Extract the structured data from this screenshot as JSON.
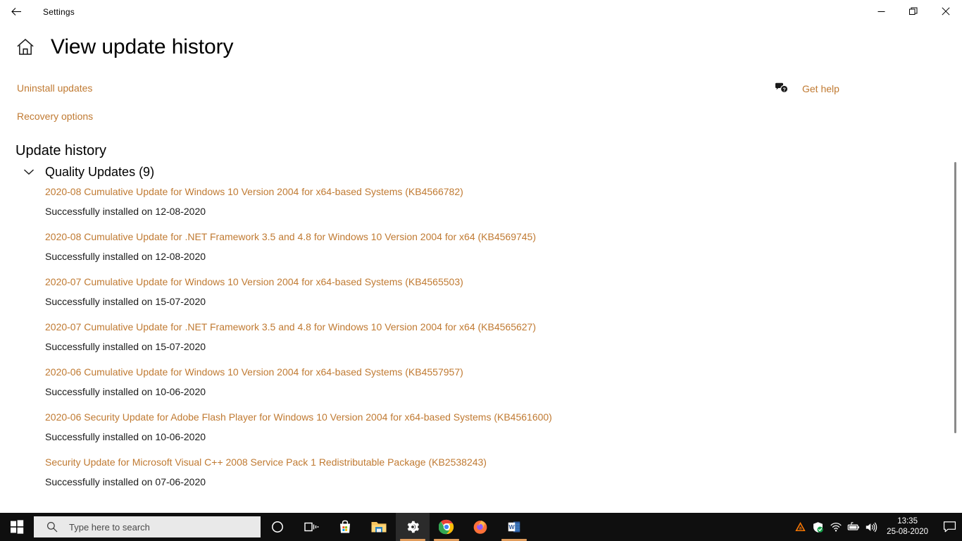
{
  "window": {
    "app_title": "Settings",
    "back_icon": "back-arrow-icon",
    "minimize_label": "–",
    "restore_label": "restore-icon",
    "close_label": "✕"
  },
  "page": {
    "home_icon": "home-icon",
    "title": "View update history"
  },
  "actions": {
    "uninstall_updates": "Uninstall updates",
    "recovery_options": "Recovery options",
    "get_help": "Get help",
    "get_help_icon": "help-bubble-icon"
  },
  "history": {
    "section_title": "Update history",
    "group": {
      "chevron_icon": "chevron-down-icon",
      "label": "Quality Updates (9)",
      "expanded": true
    },
    "items": [
      {
        "title": "2020-08 Cumulative Update for Windows 10 Version 2004 for x64-based Systems (KB4566782)",
        "status": "Successfully installed on 12-08-2020"
      },
      {
        "title": "2020-08 Cumulative Update for .NET Framework 3.5 and 4.8 for Windows 10 Version 2004 for x64 (KB4569745)",
        "status": "Successfully installed on 12-08-2020"
      },
      {
        "title": "2020-07 Cumulative Update for Windows 10 Version 2004 for x64-based Systems (KB4565503)",
        "status": "Successfully installed on 15-07-2020"
      },
      {
        "title": "2020-07 Cumulative Update for .NET Framework 3.5 and 4.8 for Windows 10 Version 2004 for x64 (KB4565627)",
        "status": "Successfully installed on 15-07-2020"
      },
      {
        "title": "2020-06 Cumulative Update for Windows 10 Version 2004 for x64-based Systems (KB4557957)",
        "status": "Successfully installed on 10-06-2020"
      },
      {
        "title": "2020-06 Security Update for Adobe Flash Player for Windows 10 Version 2004 for x64-based Systems (KB4561600)",
        "status": "Successfully installed on 10-06-2020"
      },
      {
        "title": "Security Update for Microsoft Visual C++ 2008 Service Pack 1 Redistributable Package (KB2538243)",
        "status": "Successfully installed on 07-06-2020"
      }
    ]
  },
  "taskbar": {
    "start_icon": "windows-start-icon",
    "search": {
      "icon": "search-icon",
      "placeholder": "Type here to search"
    },
    "items": [
      {
        "name": "cortana-icon",
        "label": "Cortana",
        "active": false,
        "underline": false
      },
      {
        "name": "task-view-icon",
        "label": "Task View",
        "active": false,
        "underline": false
      },
      {
        "name": "microsoft-store-icon",
        "label": "Microsoft Store",
        "active": false,
        "underline": false
      },
      {
        "name": "file-explorer-icon",
        "label": "File Explorer",
        "active": false,
        "underline": false
      },
      {
        "name": "settings-gear-icon",
        "label": "Settings",
        "active": true,
        "underline": true
      },
      {
        "name": "google-chrome-icon",
        "label": "Google Chrome",
        "active": false,
        "underline": true
      },
      {
        "name": "firefox-icon",
        "label": "Mozilla Firefox",
        "active": false,
        "underline": false
      },
      {
        "name": "word-icon",
        "label": "Microsoft Word",
        "active": false,
        "underline": true
      }
    ],
    "tray": [
      {
        "name": "avast-icon",
        "label": "Avast Antivirus"
      },
      {
        "name": "windows-security-shield-icon",
        "label": "Windows Security"
      },
      {
        "name": "wifi-icon",
        "label": "Network"
      },
      {
        "name": "battery-icon",
        "label": "Battery"
      },
      {
        "name": "volume-icon",
        "label": "Volume"
      }
    ],
    "clock": {
      "time": "13:35",
      "date": "25-08-2020"
    },
    "notifications_icon": "action-center-icon"
  },
  "colors": {
    "accent": "#C07A32",
    "link": "#C07A32",
    "taskbar_bg": "#0f0f0f",
    "search_bg": "#e9e9e9",
    "page_bg": "#ffffff"
  }
}
